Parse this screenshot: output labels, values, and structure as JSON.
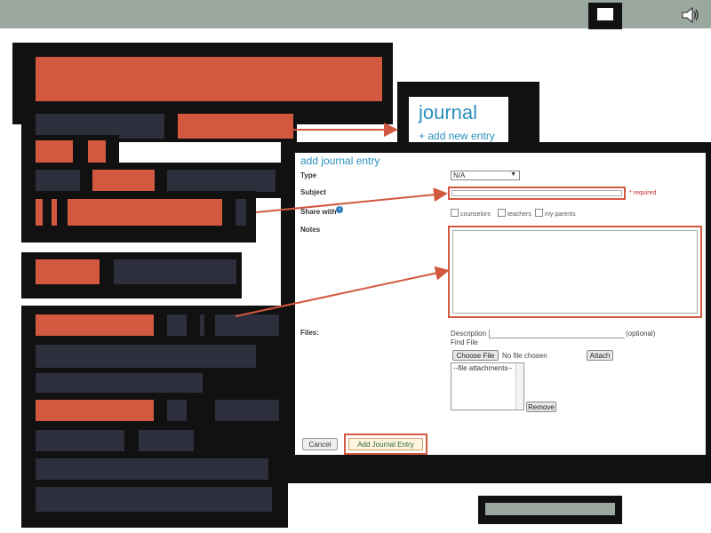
{
  "journal_panel": {
    "title": "journal",
    "add_link": "+ add new entry"
  },
  "form": {
    "title": "add journal entry",
    "type_label": "Type",
    "type_value": "N/A",
    "subject_label": "Subject",
    "required_text": "* required",
    "share_label": "Share with",
    "share_options": [
      "counselors",
      "teachers",
      "my parents"
    ],
    "notes_label": "Notes",
    "files_label": "Files:",
    "description_label": "Description",
    "optional_text": "(optional)",
    "find_file_label": "Find File",
    "choose_file_button": "Choose File",
    "no_file_text": "No file chosen",
    "attach_button": "Attach",
    "file_list_placeholder": "--file attachments--",
    "remove_button": "Remove",
    "cancel_button": "Cancel",
    "submit_button": "Add Journal Entry"
  },
  "colors": {
    "accent_orange": "#d35840",
    "dark_navy": "#2d2f3d",
    "link_blue": "#2a8fbd",
    "topbar": "#9aa89f"
  }
}
